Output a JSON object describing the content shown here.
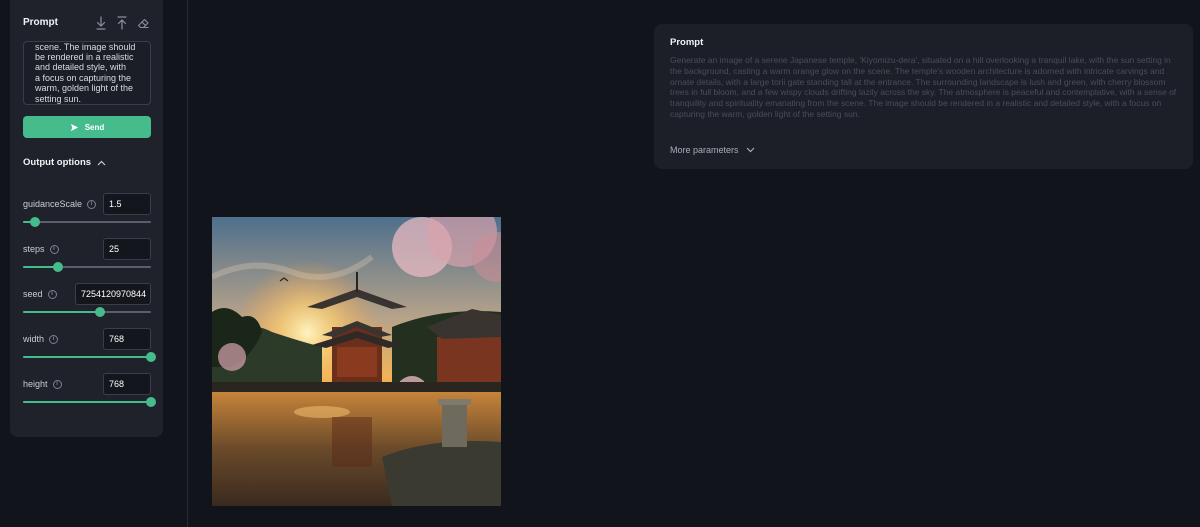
{
  "left_panel": {
    "title": "Prompt",
    "prompt_text": "scene. The image should\nbe rendered in a realistic\nand detailed style, with\na focus on capturing the\nwarm, golden light of the\nsetting sun.",
    "send_label": "Send",
    "output_options_label": "Output options",
    "icons": [
      "download-icon",
      "upload-icon",
      "eraser-icon",
      "send-icon",
      "chevron-up-icon",
      "info-icon"
    ]
  },
  "params": [
    {
      "label": "guidanceScale",
      "value": "1.5",
      "fraction": 0.09
    },
    {
      "label": "steps",
      "value": "25",
      "fraction": 0.27
    },
    {
      "label": "seed",
      "value": "7254120970844",
      "fraction": 0.6
    },
    {
      "label": "width",
      "value": "768",
      "fraction": 1.0
    },
    {
      "label": "height",
      "value": "768",
      "fraction": 1.0
    }
  ],
  "prompt_card": {
    "title": "Prompt",
    "text": "Generate an image of a serene Japanese temple, 'Kiyomizu-dera', situated on a hill overlooking a tranquil lake, with the sun setting in the background, casting a warm orange glow on the scene. The temple's wooden architecture is adorned with intricate carvings and ornate details, with a large torii gate standing tall at the entrance. The surrounding landscape is lush and green, with cherry blossom trees in full bloom, and a few wispy clouds drifting lazily across the sky. The atmosphere is peaceful and contemplative, with a sense of tranquility and spirituality emanating from the scene. The image should be rendered in a realistic and detailed style, with a focus on capturing the warm, golden light of the setting sun.",
    "more_parameters_label": "More parameters"
  },
  "colors": {
    "accent": "#46bc8d",
    "background": "#12141c",
    "panel": "#1f222b"
  }
}
